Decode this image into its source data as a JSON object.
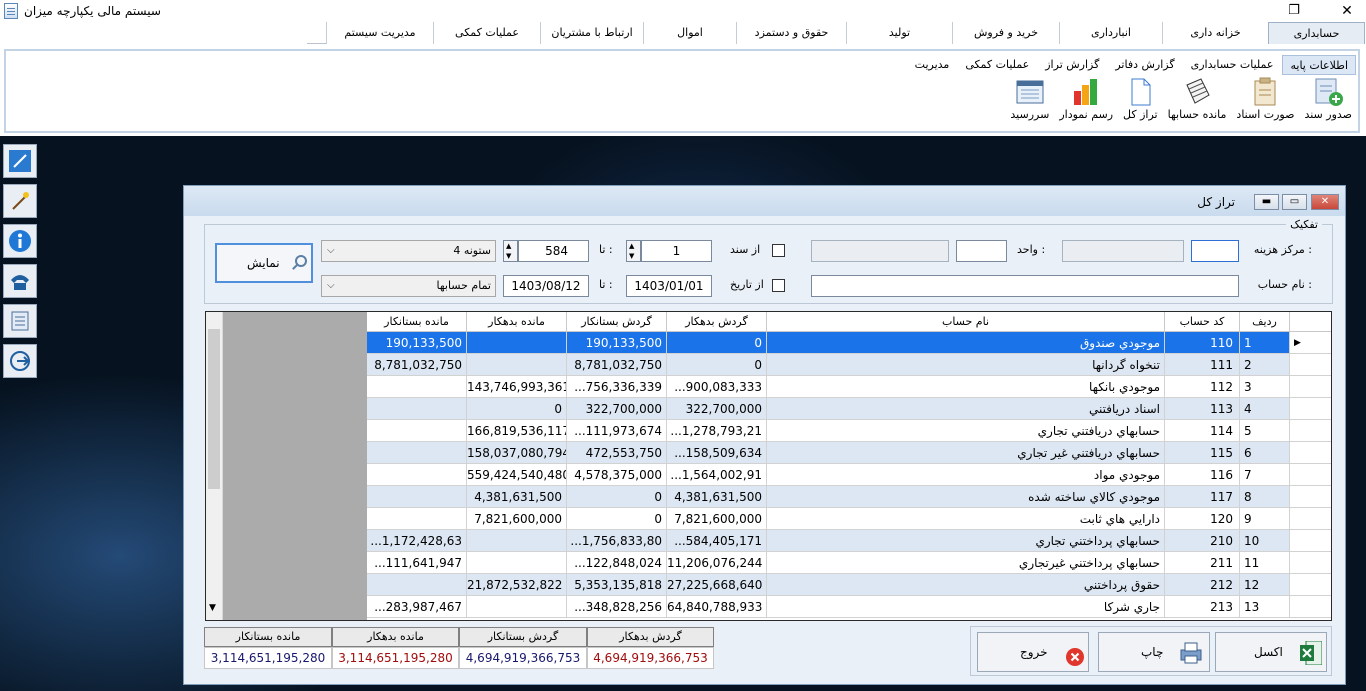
{
  "window": {
    "title": "سیستم مالی یکپارچه میزان"
  },
  "main_tabs": [
    {
      "label": "حسابداری",
      "active": true
    },
    {
      "label": "خزانه داری"
    },
    {
      "label": "انبارداری"
    },
    {
      "label": "خرید و فروش"
    },
    {
      "label": "تولید"
    },
    {
      "label": "حقوق و دستمزد"
    },
    {
      "label": "اموال"
    },
    {
      "label": "ارتباط با مشتریان"
    },
    {
      "label": "عملیات کمکی"
    },
    {
      "label": "مدیریت سیستم"
    }
  ],
  "ribbon_tabs": [
    {
      "label": "اطلاعات پایه",
      "active": true
    },
    {
      "label": "عملیات حسابداری"
    },
    {
      "label": "گزارش دفاتر"
    },
    {
      "label": "گزارش تراز"
    },
    {
      "label": "عملیات کمکی"
    },
    {
      "label": "مدیریت"
    }
  ],
  "ribbon_buttons": [
    {
      "label": "صدور سند",
      "icon": "new-document-icon"
    },
    {
      "label": "صورت اسناد",
      "icon": "documents-list-icon"
    },
    {
      "label": "مانده حسابها",
      "icon": "notebook-icon"
    },
    {
      "label": "تراز کل",
      "icon": "page-icon"
    },
    {
      "label": "رسم نمودار",
      "icon": "bar-chart-icon"
    },
    {
      "label": "سررسید",
      "icon": "calendar-icon"
    }
  ],
  "side_bar": [
    "resize-icon",
    "magic-wand-icon",
    "info-icon",
    "phone-icon",
    "notepad-icon",
    "exit-icon"
  ],
  "dialog": {
    "title": "تراز کل",
    "group_title": "تفکیک",
    "cost_center_label": "مرکز هزینه :",
    "cost_center_value": "",
    "unit_label": "واحد :",
    "unit_value": "",
    "from_doc_label": "از سند",
    "from_doc_value": "1",
    "to_doc_label": "تا :",
    "to_doc_value": "584",
    "columns_select": "4 ستونه",
    "account_name_label": "نام حساب :",
    "account_name_value": "",
    "from_date_label": "از تاریخ",
    "from_date_value": "1403/01/01",
    "to_date_label": "تا :",
    "to_date_value": "1403/08/12",
    "accounts_select": "تمام حسابها",
    "show_button": "نمایش"
  },
  "grid": {
    "headers": [
      "ردیف",
      "کد حساب",
      "نام حساب",
      "گردش بدهکار",
      "گردش بستانکار",
      "مانده بدهکار",
      "مانده بستانکار"
    ],
    "rows": [
      {
        "idx": "1",
        "code": "110",
        "name": "موجودي صندوق",
        "turn_debit": "0",
        "turn_credit": "190,133,500",
        "bal_debit": "",
        "bal_credit": "190,133,500"
      },
      {
        "idx": "2",
        "code": "111",
        "name": "تنخواه گردانها",
        "turn_debit": "0",
        "turn_credit": "8,781,032,750",
        "bal_debit": "",
        "bal_credit": "8,781,032,750"
      },
      {
        "idx": "3",
        "code": "112",
        "name": "موجودي بانكها",
        "turn_debit": "...900,083,333",
        "turn_credit": "...756,336,339",
        "bal_debit": "143,746,993,361",
        "bal_credit": ""
      },
      {
        "idx": "4",
        "code": "113",
        "name": "اسناد دريافتني",
        "turn_debit": "322,700,000",
        "turn_credit": "322,700,000",
        "bal_debit": "0",
        "bal_credit": ""
      },
      {
        "idx": "5",
        "code": "114",
        "name": "حسابهاي دريافتني تجاري",
        "turn_debit": "...1,278,793,21",
        "turn_credit": "...111,973,674",
        "bal_debit": "166,819,536,117",
        "bal_credit": ""
      },
      {
        "idx": "6",
        "code": "115",
        "name": "حسابهاي دريافتني غير تجاري",
        "turn_debit": "...158,509,634",
        "turn_credit": "472,553,750",
        "bal_debit": "158,037,080,794",
        "bal_credit": ""
      },
      {
        "idx": "7",
        "code": "116",
        "name": "موجودي مواد",
        "turn_debit": "...1,564,002,91",
        "turn_credit": "4,578,375,000",
        "bal_debit": "559,424,540,480",
        "bal_credit": ""
      },
      {
        "idx": "8",
        "code": "117",
        "name": "موجودي كالاي ساخته شده",
        "turn_debit": "4,381,631,500",
        "turn_credit": "0",
        "bal_debit": "4,381,631,500",
        "bal_credit": ""
      },
      {
        "idx": "9",
        "code": "120",
        "name": "دارايي هاي ثابت",
        "turn_debit": "7,821,600,000",
        "turn_credit": "0",
        "bal_debit": "7,821,600,000",
        "bal_credit": ""
      },
      {
        "idx": "10",
        "code": "210",
        "name": "حسابهاي پرداختني تجاري",
        "turn_debit": "...584,405,171",
        "turn_credit": "...1,756,833,80",
        "bal_debit": "",
        "bal_credit": "...1,172,428,63"
      },
      {
        "idx": "11",
        "code": "211",
        "name": "حسابهاي پرداختني غيرتجاري",
        "turn_debit": "11,206,076,244",
        "turn_credit": "...122,848,024",
        "bal_debit": "",
        "bal_credit": "...111,641,947"
      },
      {
        "idx": "12",
        "code": "212",
        "name": "حقوق پرداختني",
        "turn_debit": "27,225,668,640",
        "turn_credit": "5,353,135,818",
        "bal_debit": "21,872,532,822",
        "bal_credit": ""
      },
      {
        "idx": "13",
        "code": "213",
        "name": "جاري شركا",
        "turn_debit": "64,840,788,933",
        "turn_credit": "...348,828,256",
        "bal_debit": "",
        "bal_credit": "...283,987,467"
      }
    ]
  },
  "totals": {
    "labels": [
      "گردش بدهکار",
      "گردش بستانکار",
      "مانده بدهکار",
      "مانده بستانکار"
    ],
    "values": [
      "4,694,919,366,753",
      "4,694,919,366,753",
      "3,114,651,195,280",
      "3,114,651,195,280"
    ]
  },
  "buttons": {
    "excel": "اکسل",
    "print": "چاپ",
    "exit": "خروج"
  }
}
